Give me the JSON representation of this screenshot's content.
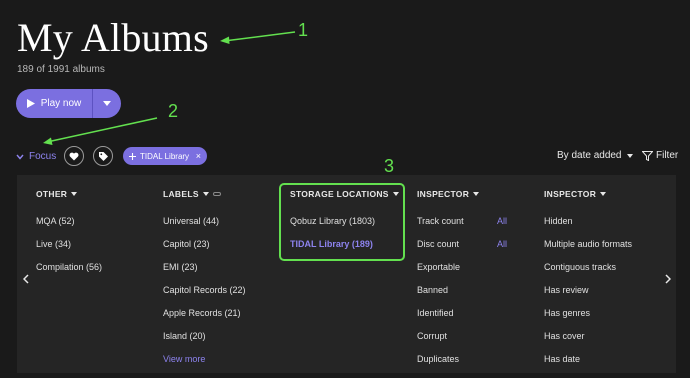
{
  "header": {
    "title": "My Albums",
    "subtitle": "189 of 1991 albums"
  },
  "play": {
    "label": "Play now"
  },
  "toolbar": {
    "focus_label": "Focus",
    "chip_label": "TIDAL Library",
    "chip_close": "×",
    "sort_label": "By date added",
    "filter_label": "Filter"
  },
  "annotations": {
    "n1": "1",
    "n2": "2",
    "n3": "3",
    "color": "#63e04f"
  },
  "panel": {
    "other": {
      "header": "OTHER",
      "items": [
        "MQA (52)",
        "Live (34)",
        "Compilation (56)"
      ]
    },
    "labels": {
      "header": "LABELS",
      "items": [
        "Universal (44)",
        "Capitol (23)",
        "EMI (23)",
        "Capitol Records (22)",
        "Apple Records (21)",
        "Island (20)"
      ],
      "more": "View more"
    },
    "storage": {
      "header": "STORAGE LOCATIONS",
      "items": [
        "Qobuz Library (1803)",
        "TIDAL Library (189)"
      ]
    },
    "inspector1": {
      "header": "INSPECTOR",
      "items": [
        "Track count",
        "Disc count",
        "Exportable",
        "Banned",
        "Identified",
        "Corrupt",
        "Duplicates"
      ],
      "all": "All"
    },
    "inspector2": {
      "header": "INSPECTOR",
      "items": [
        "Hidden",
        "Multiple audio formats",
        "Contiguous tracks",
        "Has review",
        "Has genres",
        "Has cover",
        "Has date"
      ]
    }
  },
  "colors": {
    "accent": "#7b6fe0",
    "background": "#1a1a1a",
    "panel": "#252525"
  },
  "icons": [
    "play-icon",
    "chevron-down-icon",
    "heart-icon",
    "tag-icon",
    "plus-icon",
    "filter-icon",
    "link-icon",
    "chevron-left-icon",
    "chevron-right-icon"
  ]
}
